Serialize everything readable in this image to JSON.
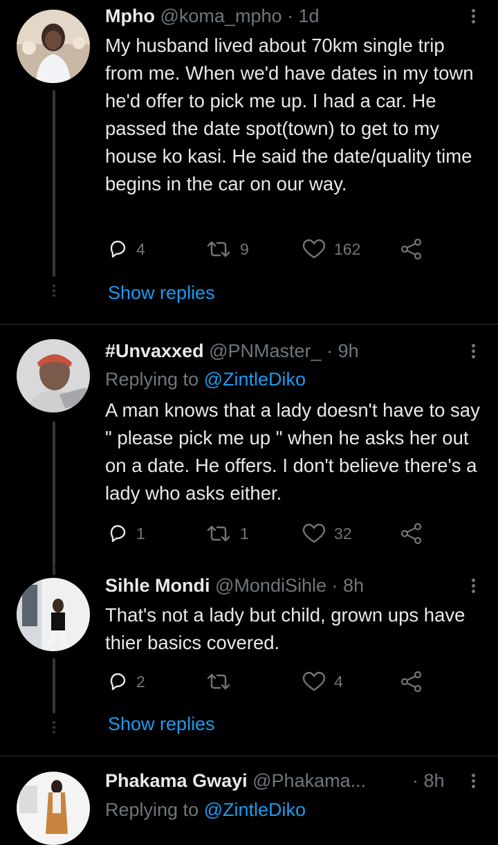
{
  "tweets": [
    {
      "name": "Mpho",
      "handle": "@koma_mpho",
      "sep": "·",
      "time": "1d",
      "body": "My husband lived about 70km single trip from me. When we'd have dates in my town he'd offer to pick me up. I had a car. He passed the date spot(town) to get to my house ko kasi. He said the date/quality time begins in the car on our way.",
      "replies": "4",
      "retweets": "9",
      "likes": "162",
      "show_replies": "Show replies"
    },
    {
      "name": "#Unvaxxed",
      "handle": "@PNMaster_",
      "sep": "·",
      "time": "9h",
      "replying_prefix": "Replying to",
      "replying_to": "@ZintleDiko",
      "body": "A man knows that a lady doesn't have to say \" please pick me up \" when he asks her out on a date. He offers. I don't believe there's a lady who asks either.",
      "replies": "1",
      "retweets": "1",
      "likes": "32"
    },
    {
      "name": "Sihle Mondi",
      "handle": "@MondiSihle",
      "sep": "·",
      "time": "8h",
      "body": "That's not a lady but child, grown ups have thier basics covered.",
      "replies": "2",
      "retweets": "",
      "likes": "4",
      "show_replies": "Show replies"
    },
    {
      "name": "Phakama Gwayi",
      "handle": "@Phakama...",
      "sep": "·",
      "time": "8h",
      "replying_prefix": "Replying to",
      "replying_to": "@ZintleDiko"
    }
  ],
  "icons": {
    "reply": "reply-icon",
    "retweet": "retweet-icon",
    "like": "heart-icon",
    "share": "share-icon",
    "more": "more-icon"
  },
  "colors": {
    "background": "#000000",
    "text": "#e7e9ea",
    "secondary": "#71767b",
    "link": "#1d9bf0",
    "divider": "#2f3336"
  }
}
